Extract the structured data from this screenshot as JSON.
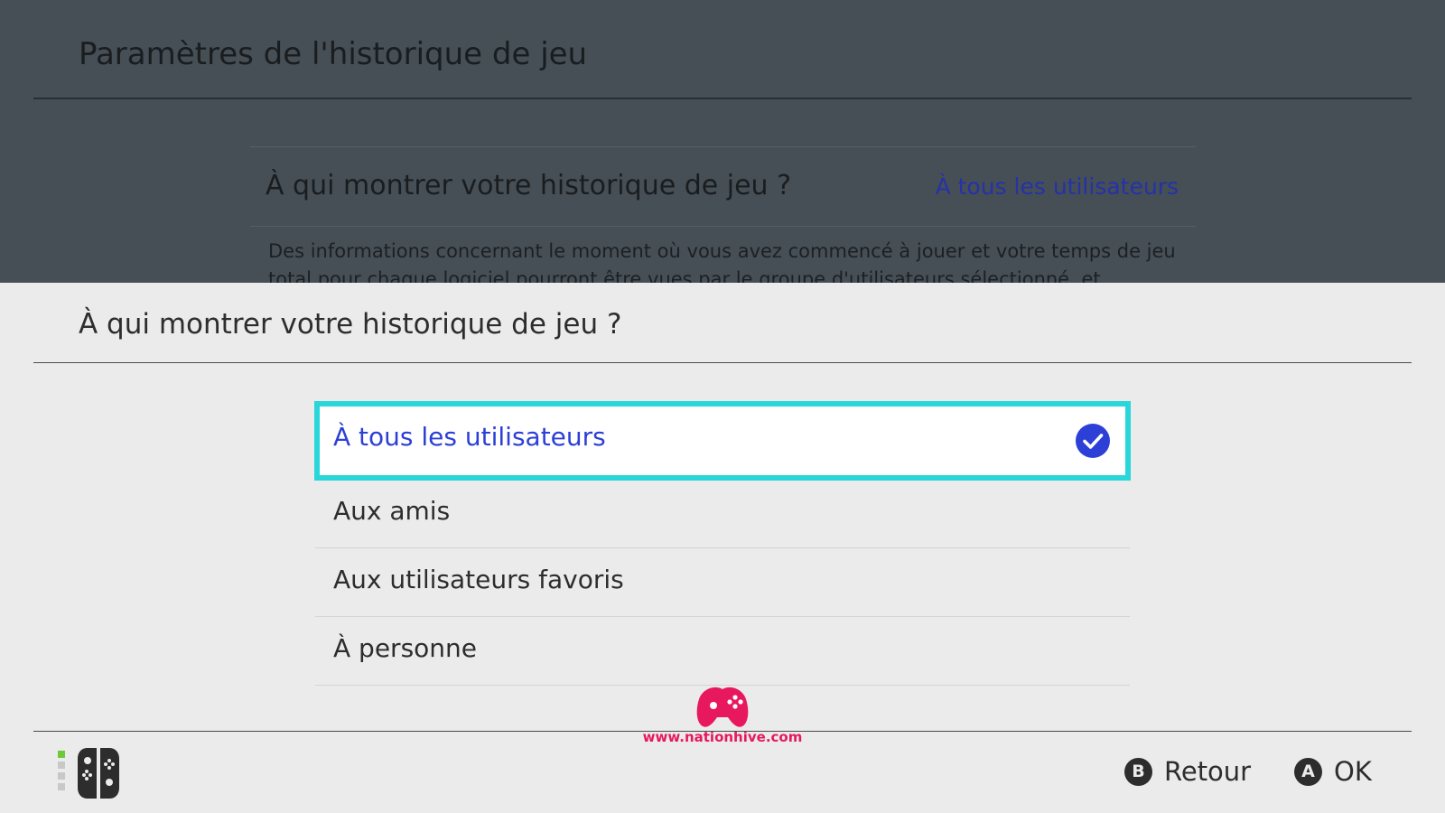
{
  "background_screen": {
    "title": "Paramètres de l'historique de jeu",
    "row_label": "À qui montrer votre historique de jeu ?",
    "row_value": "À tous les utilisateurs",
    "description": "Des informations concernant le moment où vous avez commencé à jouer et votre temps de jeu total pour chaque logiciel pourront être vues par le groupe d'utilisateurs sélectionné, et"
  },
  "popup": {
    "title": "À qui montrer votre historique de jeu ?",
    "options": [
      {
        "label": "À tous les utilisateurs",
        "selected": true
      },
      {
        "label": "Aux amis",
        "selected": false
      },
      {
        "label": "Aux utilisateurs favoris",
        "selected": false
      },
      {
        "label": "À personne",
        "selected": false
      }
    ]
  },
  "watermark": {
    "text": "www.nationhive.com",
    "icon": "gamepad-logo-icon"
  },
  "footer": {
    "controller_icon": "joycon-icon",
    "back": {
      "button": "B",
      "label": "Retour"
    },
    "ok": {
      "button": "A",
      "label": "OK"
    }
  },
  "colors": {
    "accent_blue": "#2c3fd6",
    "focus_cyan": "#29d7da",
    "watermark_pink": "#e8185f",
    "dim_overlay": "#464f55"
  }
}
